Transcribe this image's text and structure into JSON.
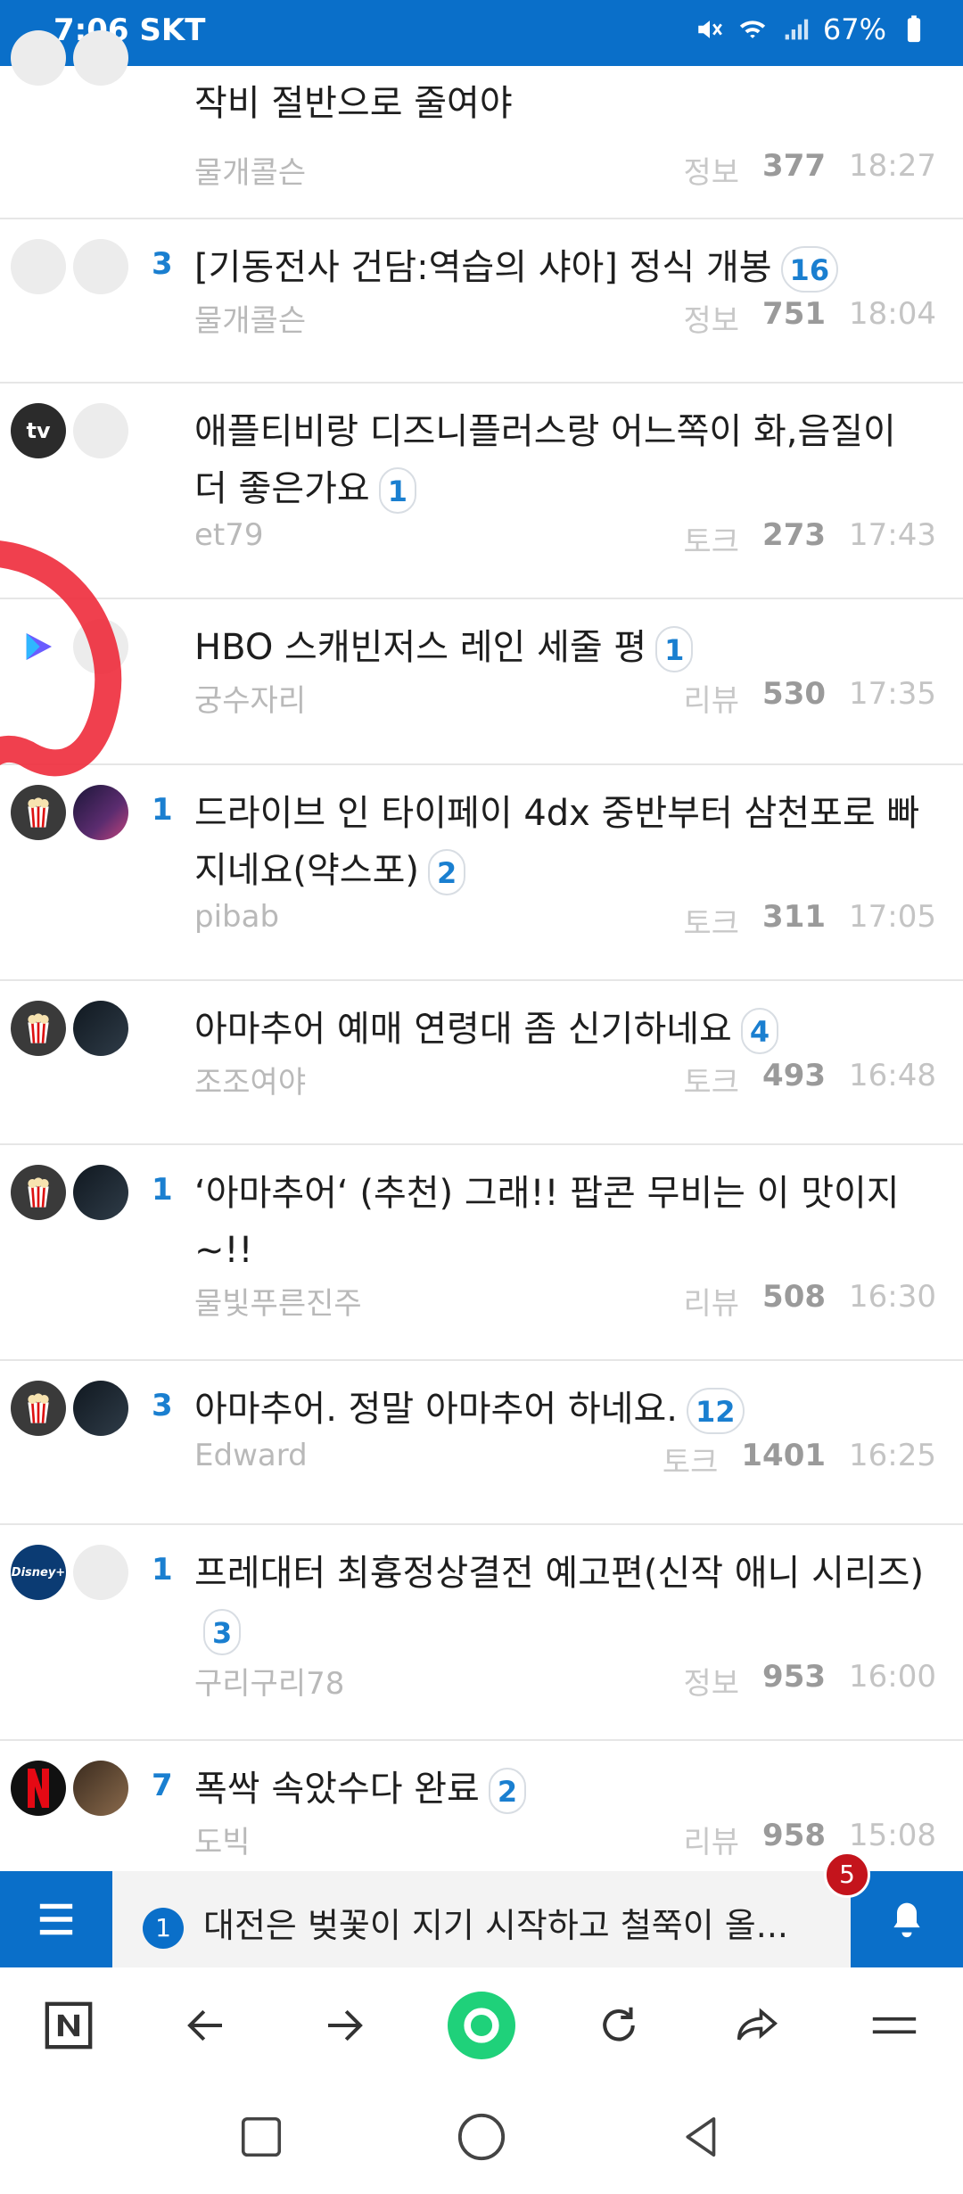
{
  "status_bar": {
    "time": "7:06",
    "carrier": "SKT",
    "battery": "67%"
  },
  "posts": [
    {
      "num": "",
      "title": "작비 절반으로 줄여야",
      "comments": "",
      "author": "물개콜슨",
      "category": "정보",
      "views": "377",
      "time": "18:27"
    },
    {
      "num": "3",
      "title": "[기동전사 건담:역습의 샤아] 정식 개봉",
      "comments": "16",
      "author": "물개콜슨",
      "category": "정보",
      "views": "751",
      "time": "18:04"
    },
    {
      "num": "",
      "title": "애플티비랑 디즈니플러스랑 어느쪽이 화,음질이 더 좋은가요",
      "comments": "1",
      "author": "et79",
      "category": "토크",
      "views": "273",
      "time": "17:43"
    },
    {
      "num": "",
      "title": "HBO 스캐빈저스 레인 세줄 평",
      "comments": "1",
      "author": "궁수자리",
      "category": "리뷰",
      "views": "530",
      "time": "17:35"
    },
    {
      "num": "1",
      "title": "드라이브 인 타이페이 4dx 중반부터 삼천포로 빠지네요(약스포)",
      "comments": "2",
      "author": "pibab",
      "category": "토크",
      "views": "311",
      "time": "17:05"
    },
    {
      "num": "",
      "title": "아마추어 예매 연령대 좀 신기하네요",
      "comments": "4",
      "author": "조조여야",
      "category": "토크",
      "views": "493",
      "time": "16:48"
    },
    {
      "num": "1",
      "title": "‘아마추어‘ (추천) 그래!! 팝콘 무비는 이 맛이지~!!",
      "comments": "",
      "author": "물빛푸른진주",
      "category": "리뷰",
      "views": "508",
      "time": "16:30"
    },
    {
      "num": "3",
      "title": "아마추어. 정말 아마추어 하네요.",
      "comments": "12",
      "author": "Edward",
      "category": "토크",
      "views": "1401",
      "time": "16:25"
    },
    {
      "num": "1",
      "title": "프레대터 최흉정상결전 예고편(신작 애니 시리즈)",
      "comments": "3",
      "author": "구리구리78",
      "category": "정보",
      "views": "953",
      "time": "16:00"
    },
    {
      "num": "7",
      "title": "폭싹 속았수다 완료",
      "comments": "2",
      "author": "도빅",
      "category": "리뷰",
      "views": "958",
      "time": "15:08"
    }
  ],
  "avatar_labels": {
    "appletv": "tv",
    "disney": "Disney+"
  },
  "notification": {
    "count": "1",
    "text": "대전은 벚꽃이 지기 시작하고 철쭉이 올...",
    "bell_badge": "5"
  },
  "colors": {
    "brand": "#0a6fc9",
    "accent_blue": "#1a7fd0",
    "badge_red": "#c4141c",
    "green": "#1fd17a"
  }
}
